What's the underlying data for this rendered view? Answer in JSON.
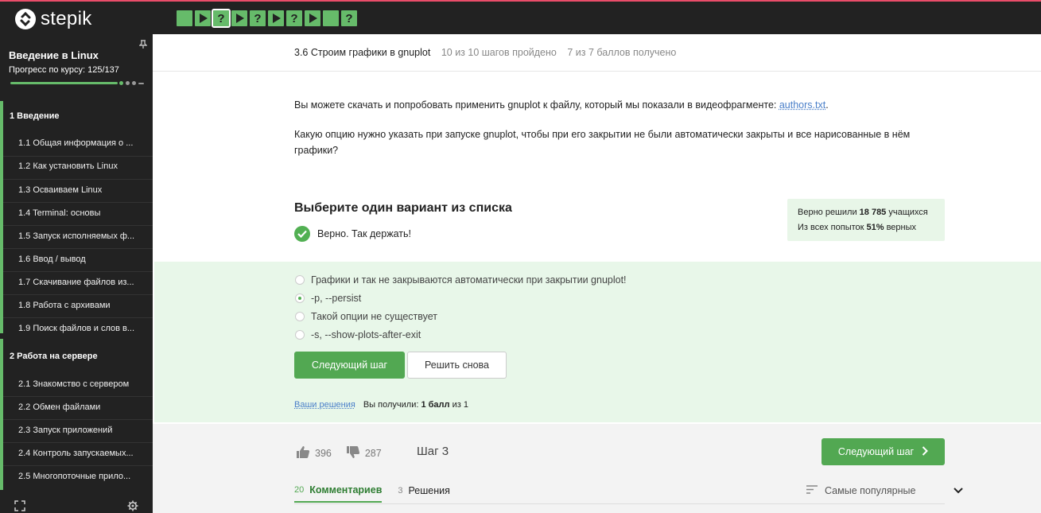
{
  "app": {
    "name": "stepik"
  },
  "steps_nav": [
    {
      "type": "done"
    },
    {
      "type": "video"
    },
    {
      "type": "quiz",
      "current": true
    },
    {
      "type": "video"
    },
    {
      "type": "quiz"
    },
    {
      "type": "video"
    },
    {
      "type": "quiz"
    },
    {
      "type": "video"
    },
    {
      "type": "done"
    },
    {
      "type": "quiz"
    }
  ],
  "sidebar": {
    "course_title": "Введение в Linux",
    "progress_text": "Прогресс по курсу:  125/137",
    "progress_fraction": 0.912,
    "modules": [
      {
        "title": "1  Введение",
        "lessons": [
          "1.1  Общая информация о ...",
          "1.2  Как установить Linux",
          "1.3  Осваиваем Linux",
          "1.4  Terminal: основы",
          "1.5  Запуск исполняемых ф...",
          "1.6  Ввод / вывод",
          "1.7  Скачивание файлов из...",
          "1.8  Работа с архивами",
          "1.9  Поиск файлов и слов в..."
        ]
      },
      {
        "title": "2  Работа на сервере",
        "lessons": [
          "2.1  Знакомство с сервером",
          "2.2  Обмен файлами",
          "2.3  Запуск приложений",
          "2.4  Контроль запускаемых...",
          "2.5  Многопоточные прило..."
        ]
      }
    ]
  },
  "header": {
    "lesson_title": "3.6 Строим графики в gnuplot",
    "steps_done": "10 из 10 шагов пройдено",
    "points": "7 из 7 баллов  получено"
  },
  "content": {
    "para1_text": "Вы можете скачать и попробовать применить gnuplot к файлу, который мы показали в видеофрагменте: ",
    "para1_link": "authors.txt",
    "para1_end": ".",
    "question": "Какую опцию нужно указать при запуске gnuplot, чтобы при его закрытии не были автоматически закрыты и все нарисованные в нём графики?"
  },
  "quiz": {
    "title": "Выберите один вариант из списка",
    "feedback": "Верно. Так держать!",
    "stats_line1_pre": "Верно решили ",
    "stats_line1_num": "18 785",
    "stats_line1_post": " учащихся",
    "stats_line2_pre": "Из всех попыток ",
    "stats_line2_num": "51%",
    "stats_line2_post": " верных",
    "options": [
      "Графики и так не закрываются автоматически при закрытии gnuplot!",
      "-p, --persist",
      "Такой опции не существует",
      "-s, --show-plots-after-exit"
    ],
    "selected_index": 1,
    "next_button": "Следующий шаг",
    "retry_button": "Решить снова",
    "your_solutions": "Ваши решения",
    "score_pre": "Вы получили: ",
    "score_bold": "1 балл",
    "score_post": " из 1"
  },
  "footer": {
    "likes": "396",
    "dislikes": "287",
    "step_label": "Шаг 3",
    "next_button": "Следующий шаг",
    "tabs": [
      {
        "count": "20",
        "label": "Комментариев",
        "active": true
      },
      {
        "count": "3",
        "label": "Решения",
        "active": false
      }
    ],
    "sort_label": "Самые популярные"
  },
  "colors": {
    "accent_green": "#52a852",
    "topbar_bg": "#222222",
    "answers_bg": "#e8f7e9"
  }
}
